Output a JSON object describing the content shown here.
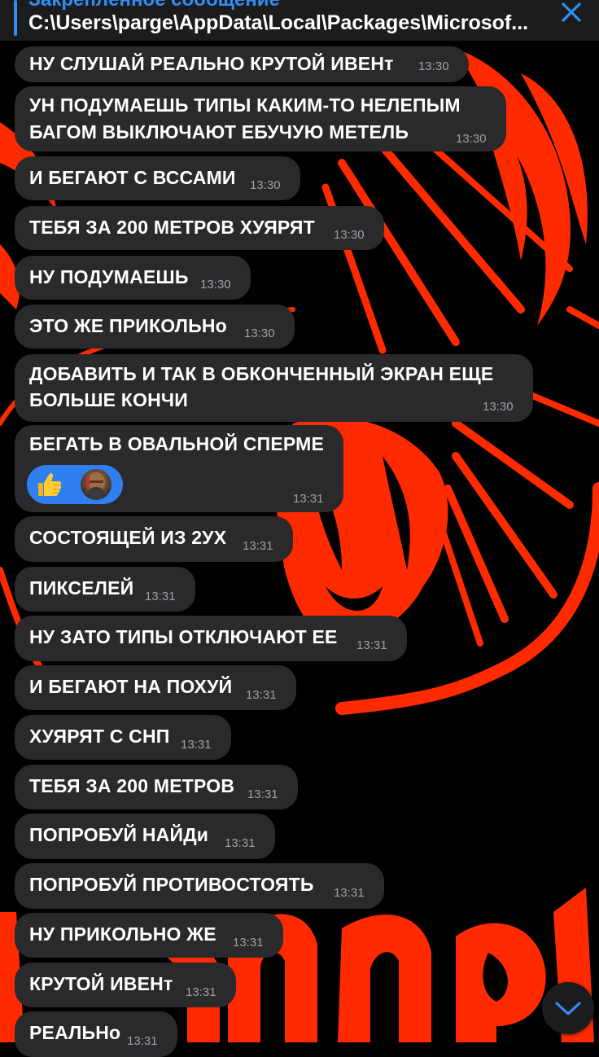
{
  "pinned": {
    "label": "Закреплённое сообщение",
    "text": "C:\\Users\\parge\\AppData\\Local\\Packages\\Microsof..."
  },
  "messages": [
    {
      "text": "НУ СЛУШАЙ РЕАЛЬНО КРУТОЙ ИВЕНт",
      "time": "13:30"
    },
    {
      "lines": [
        "УН ПОДУМАЕШЬ ТИПЫ КАКИМ-ТО НЕЛЕПЫМ",
        "БАГОМ ВЫКЛЮЧАЮТ ЕБУЧУЮ МЕТЕЛЬ"
      ],
      "time": "13:30"
    },
    {
      "text": "И БЕГАЮТ С ВССАМИ",
      "time": "13:30"
    },
    {
      "text": "ТЕБЯ ЗА 200 МЕТРОВ ХУЯРЯТ",
      "time": "13:30"
    },
    {
      "text": "НУ ПОДУМАЕШЬ",
      "time": "13:30"
    },
    {
      "text": "ЭТО ЖЕ ПРИКОЛЬНо",
      "time": "13:30"
    },
    {
      "lines": [
        "ДОБАВИТЬ И ТАК В ОБКОНЧЕННЫЙ ЭКРАН ЕЩЕ",
        "БОЛЬШЕ КОНЧИ"
      ],
      "time": "13:30"
    },
    {
      "text": "БЕГАТЬ В ОВАЛЬНОЙ СПЕРМЕ",
      "time": "13:31",
      "reaction": {
        "emoji": "thumbs-up-icon",
        "reactor": "avatar"
      }
    },
    {
      "text": "СОСТОЯЩЕЙ ИЗ 2УХ",
      "time": "13:31"
    },
    {
      "text": "ПИКСЕЛЕЙ",
      "time": "13:31"
    },
    {
      "text": "НУ ЗАТО ТИПЫ ОТКЛЮЧАЮТ ЕЕ",
      "time": "13:31"
    },
    {
      "text": "И БЕГАЮТ НА ПОХУЙ",
      "time": "13:31"
    },
    {
      "text": "ХУЯРЯТ С СНП",
      "time": "13:31"
    },
    {
      "text": "ТЕБЯ ЗА 200 МЕТРОВ",
      "time": "13:31"
    },
    {
      "text": "ПОПРОБУЙ НАЙДи",
      "time": "13:31"
    },
    {
      "text": "ПОПРОБУЙ ПРОТИВОСТОЯТЬ",
      "time": "13:31"
    },
    {
      "text": "НУ ПРИКОЛЬНО ЖЕ",
      "time": "13:31"
    },
    {
      "text": "КРУТОЙ ИВЕНт",
      "time": "13:31"
    },
    {
      "text": "РЕАЛЬНо",
      "time": "13:31"
    }
  ],
  "colors": {
    "accent": "#2f8ef4",
    "bubble": "#2a2a2c",
    "wallpaper_red": "#ff2a00",
    "reaction_bg": "#2f7ff0"
  },
  "icons": {
    "close": "close-icon",
    "scroll_down": "chevron-down-icon"
  }
}
